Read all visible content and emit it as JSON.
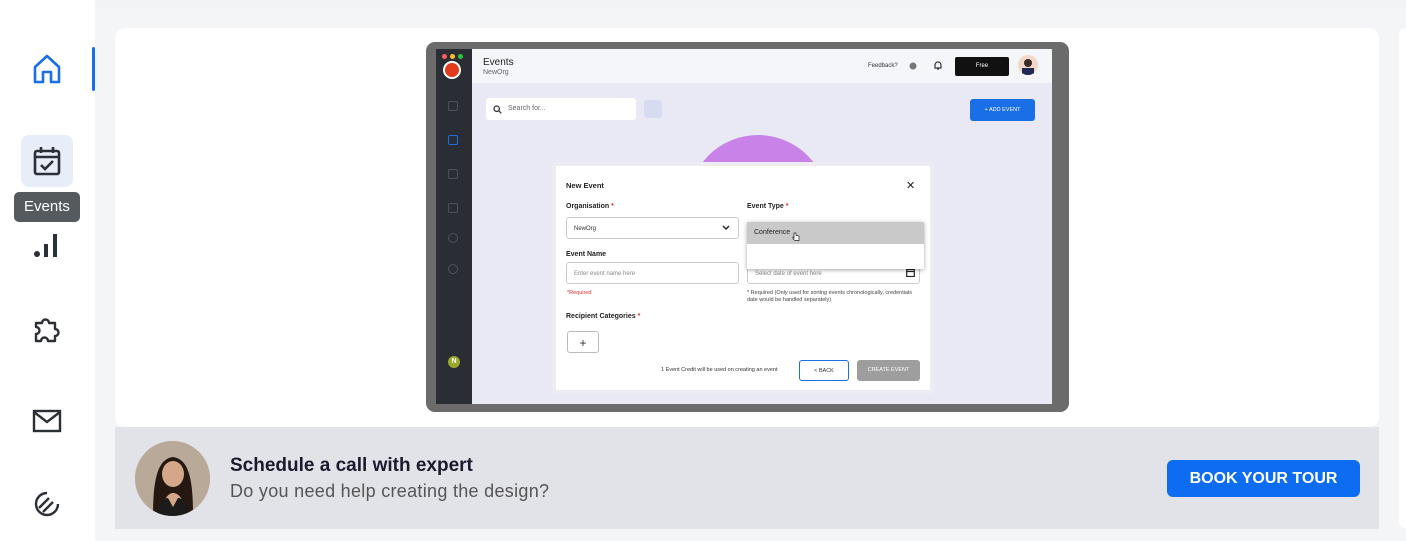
{
  "sidebar": {
    "tooltip": "Events",
    "icons": [
      "home-icon",
      "calendar-check-icon",
      "bar-chart-icon",
      "puzzle-icon",
      "mail-icon",
      "support-icon"
    ]
  },
  "preview": {
    "header": {
      "title": "Events",
      "subtitle": "NewOrg",
      "feedback": "Feedback?",
      "plan": "Free"
    },
    "search_placeholder": "Search for...",
    "add_event": "+ ADD EVENT",
    "sidebar_avatar_initial": "N",
    "modal": {
      "title": "New Event",
      "close": "✕",
      "organisation_label": "Organisation",
      "organisation_value": "NewOrg",
      "event_type_label": "Event Type",
      "event_type_option": "Conference",
      "event_name_label": "Event Name",
      "event_name_placeholder": "Enter event name here",
      "required_hint": "*Required",
      "date_placeholder": "Select date of event here",
      "date_note": "* Required (Only used for sorting events chronologically, credentials date would be handled separately)",
      "recipient_label": "Recipient Categories",
      "add": "+",
      "credit_note": "1 Event Credit will be used on creating an event",
      "back": "BACK",
      "create": "CREATE EVENT",
      "required_star": "*"
    }
  },
  "footer": {
    "title": "Schedule a call with expert",
    "subtitle": "Do you need help creating the design?",
    "button": "BOOK YOUR TOUR"
  },
  "colors": {
    "accent": "#0c6cf2",
    "tooltip_bg": "#555a5f",
    "circle": "#c882e8"
  }
}
